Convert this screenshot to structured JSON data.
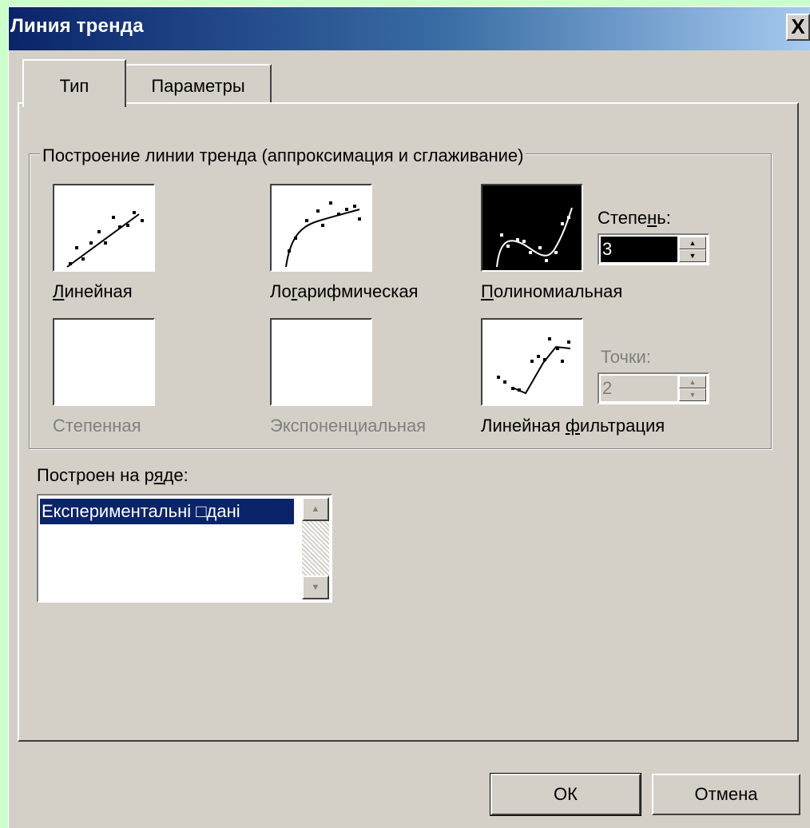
{
  "window": {
    "title": "Линия тренда",
    "close_label": "X"
  },
  "tabs": [
    {
      "label": "Тип",
      "selected": true
    },
    {
      "label": "Параметры",
      "selected": false
    }
  ],
  "group": {
    "legend": "Построение линии тренда (аппроксимация и сглаживание)"
  },
  "trend_types": {
    "linear": {
      "label": "Линейная",
      "mnemonic": "Л",
      "rest": "инейная",
      "enabled": true,
      "selected": false
    },
    "log": {
      "label": "Логарифмическая",
      "pre": "Ло",
      "mnemonic": "г",
      "rest": "арифмическая",
      "enabled": true,
      "selected": false
    },
    "poly": {
      "label": "Полиномиальная",
      "mnemonic": "П",
      "rest": "олиномиальная",
      "enabled": true,
      "selected": true
    },
    "power": {
      "label": "Степенная",
      "enabled": false,
      "selected": false
    },
    "exp": {
      "label": "Экспоненциальная",
      "enabled": false,
      "selected": false
    },
    "filter": {
      "label": "Линейная фильтрация",
      "pre": "Линейная ",
      "mnemonic": "ф",
      "rest": "ильтрация",
      "enabled": true,
      "selected": false
    }
  },
  "degree": {
    "label": "Степень:",
    "pre": "Степе",
    "mnemonic": "н",
    "rest": "ь:",
    "value": "3"
  },
  "points": {
    "label": "Точки:",
    "value": "2",
    "enabled": false
  },
  "series": {
    "label": "Построен на ряде:",
    "pre": "Построен на р",
    "mnemonic": "я",
    "rest": "де:",
    "items": [
      "Експериментальні □дані"
    ]
  },
  "buttons": {
    "ok": "ОК",
    "cancel": "Отмена"
  },
  "colors": {
    "accent": "#0a246a",
    "face": "#d4d0c8",
    "background": "#ccffcc"
  }
}
